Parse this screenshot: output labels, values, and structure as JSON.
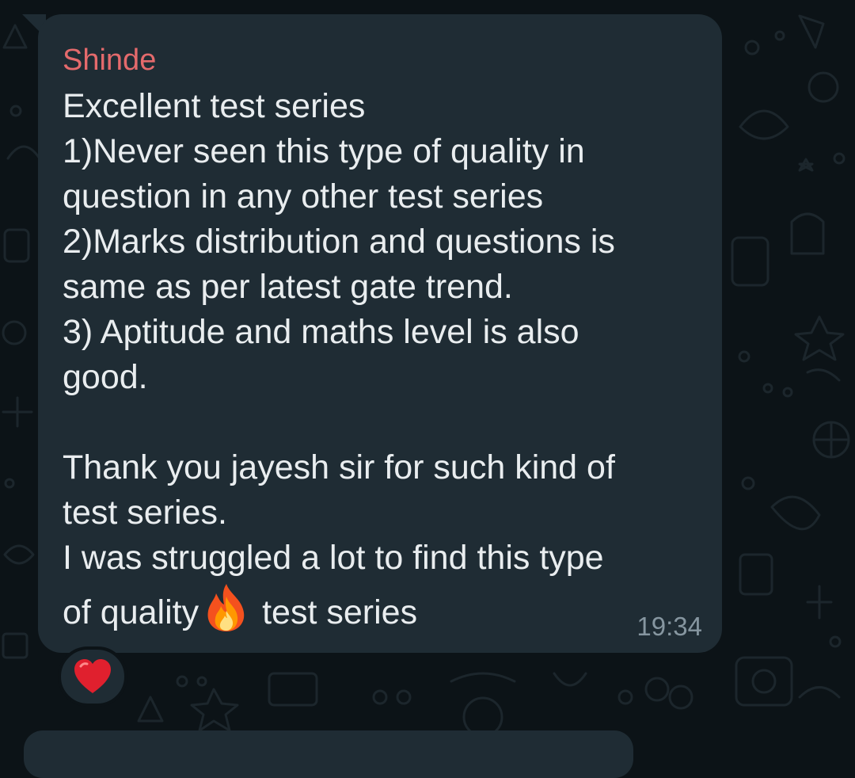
{
  "message": {
    "sender": "Shinde",
    "lines": [
      "Excellent test series",
      "1)Never seen this type of quality in",
      "question in any other test series",
      "2)Marks distribution and questions is",
      "same as per latest gate trend.",
      "3) Aptitude and maths level is also",
      "good.",
      "",
      "Thank you jayesh sir for such kind of",
      "test series.",
      "I was struggled a lot to find this type"
    ],
    "last_line_before_emoji": "of quality",
    "emoji": "fire-emoji",
    "last_line_after_emoji": "test series",
    "time": "19:34"
  },
  "reaction": {
    "emoji": "red-heart-emoji"
  },
  "colors": {
    "background": "#0c1317",
    "bubble": "#1f2c34",
    "sender_name": "#e46a6c",
    "text": "#e9edef",
    "timestamp": "#8696a0"
  }
}
